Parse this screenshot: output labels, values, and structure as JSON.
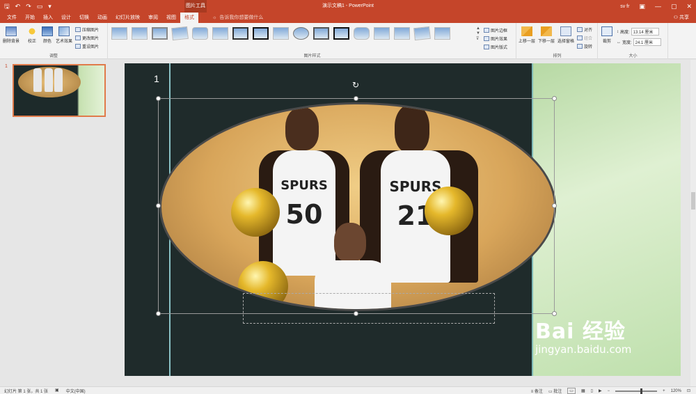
{
  "titlebar": {
    "context_tools": "图片工具",
    "doc_title": "演示文稿1  -  PowerPoint",
    "user": "sv fr",
    "icons": [
      "save-icon",
      "undo-icon",
      "redo-icon",
      "customize-icon"
    ]
  },
  "tabs": {
    "items": [
      "文件",
      "开始",
      "插入",
      "设计",
      "切换",
      "动画",
      "幻灯片放映",
      "审阅",
      "视图",
      "格式"
    ],
    "active_index": 9,
    "tellme": "告诉我你想要做什么",
    "share": "共享"
  },
  "ribbon": {
    "adjust": {
      "label": "调整",
      "remove_bg": "删除背景",
      "correct": "校正",
      "color": "颜色",
      "artistic": "艺术效果",
      "compress": "压缩图片",
      "change": "更改图片",
      "reset": "重设图片"
    },
    "styles": {
      "label": "图片样式",
      "border": "图片边框",
      "effects": "图片效果",
      "layout": "图片版式"
    },
    "arrange": {
      "label": "排列",
      "bring_forward": "上移一层",
      "send_backward": "下移一层",
      "selection_pane": "选择窗格",
      "align": "对齐",
      "group": "组合",
      "rotate": "旋转"
    },
    "size": {
      "label": "大小",
      "crop": "裁剪",
      "height_label": "高度:",
      "height_value": "13.14 厘米",
      "width_label": "宽度:",
      "width_value": "24.1 厘米"
    }
  },
  "thumbpane": {
    "slide_number": "1"
  },
  "slide": {
    "number_text": "1",
    "jersey_text": {
      "left": "SPURS",
      "left_number": "50",
      "right": "SPURS",
      "right_number": "21"
    },
    "watermark": {
      "brand": "Bai  经验",
      "url": "jingyan.baidu.com"
    }
  },
  "statusbar": {
    "slide_info": "幻灯片 第 1 张，共 1 张",
    "language": "中文(中国)",
    "notes": "备注",
    "comments": "批注",
    "zoom": "120%"
  }
}
